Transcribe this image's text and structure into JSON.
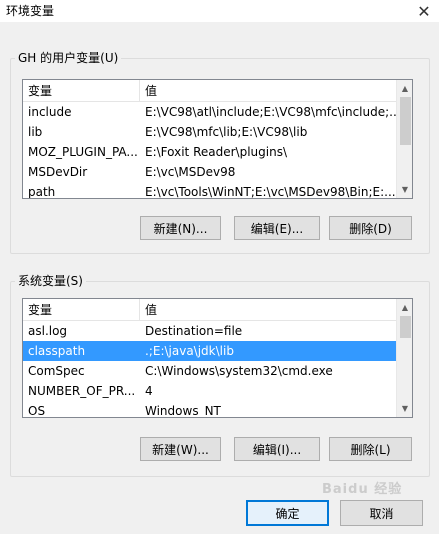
{
  "window": {
    "title": "环境变量",
    "close_glyph": "✕"
  },
  "user_group": {
    "label": "GH 的用户变量(U)",
    "columns": [
      "变量",
      "值"
    ],
    "rows": [
      {
        "name": "include",
        "value": "E:\\VC98\\atl\\include;E:\\VC98\\mfc\\include;..."
      },
      {
        "name": "lib",
        "value": "E:\\VC98\\mfc\\lib;E:\\VC98\\lib"
      },
      {
        "name": "MOZ_PLUGIN_PA...",
        "value": "E:\\Foxit Reader\\plugins\\"
      },
      {
        "name": "MSDevDir",
        "value": "E:\\vc\\MSDev98"
      },
      {
        "name": "path",
        "value": "E:\\vc\\Tools\\WinNT;E:\\vc\\MSDev98\\Bin;E:..."
      }
    ],
    "buttons": {
      "new": "新建(N)...",
      "edit": "编辑(E)...",
      "delete": "删除(D)"
    }
  },
  "system_group": {
    "label": "系统变量(S)",
    "columns": [
      "变量",
      "值"
    ],
    "rows": [
      {
        "name": "asl.log",
        "value": "Destination=file"
      },
      {
        "name": "classpath",
        "value": ".;E:\\java\\jdk\\lib"
      },
      {
        "name": "ComSpec",
        "value": "C:\\Windows\\system32\\cmd.exe"
      },
      {
        "name": "NUMBER_OF_PR...",
        "value": "4"
      },
      {
        "name": "OS",
        "value": "Windows_NT"
      }
    ],
    "selected_row": 1,
    "buttons": {
      "new": "新建(W)...",
      "edit": "编辑(I)...",
      "delete": "删除(L)"
    }
  },
  "footer": {
    "ok": "确定",
    "cancel": "取消"
  },
  "colors": {
    "selection": "#3399ff",
    "default_button_border": "#0078d7"
  },
  "watermark": "Baidu 经验"
}
